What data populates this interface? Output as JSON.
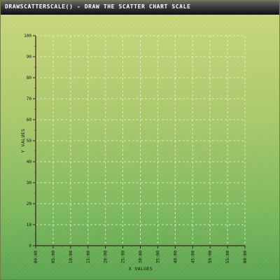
{
  "title": "DRAWSCATTERSCALE() - DRAW THE SCATTER CHART SCALE",
  "colors": {
    "axis": "#3a1f1f",
    "grid": "#f3f3d8",
    "tick_mark": "#c0403a",
    "title_text": "#ffffff"
  },
  "chart_data": {
    "type": "scatter",
    "title": "DRAWSCATTERSCALE() - DRAW THE SCATTER CHART SCALE",
    "xlabel": "X VALUES",
    "ylabel": "Y VALUES",
    "ylim": [
      0,
      100
    ],
    "yticks": [
      0,
      10,
      20,
      30,
      40,
      50,
      60,
      70,
      80,
      90,
      100
    ],
    "xticks": [
      "00:00",
      "05:00",
      "10:00",
      "15:00",
      "20:00",
      "25:00",
      "30:00",
      "35:00",
      "40:00",
      "45:00",
      "50:00",
      "55:00",
      "00:00"
    ],
    "grid": true,
    "series": []
  }
}
